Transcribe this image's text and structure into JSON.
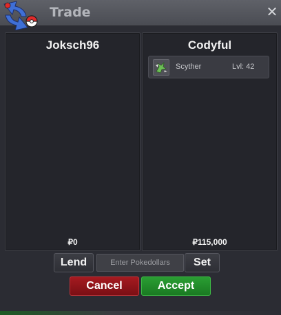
{
  "window": {
    "title": "Trade",
    "close_symbol": "✕",
    "logo_icon": "pokemon-trade-arrows-icon",
    "close_icon": "close-icon"
  },
  "left_panel": {
    "trainer": "Joksch96",
    "money": "₽0"
  },
  "right_panel": {
    "trainer": "Codyful",
    "money": "₽115,000",
    "items": [
      {
        "icon": "scyther-sprite-icon",
        "name": "Scyther",
        "level": "Lvl: 42"
      }
    ]
  },
  "controls": {
    "lend_label": "Lend",
    "pokedollars_placeholder": "Enter Pokedollars",
    "set_label": "Set",
    "cancel_label": "Cancel",
    "accept_label": "Accept"
  },
  "colors": {
    "cancel": "#8f1419",
    "accept": "#248a2c",
    "titlebar": "#55575e"
  }
}
